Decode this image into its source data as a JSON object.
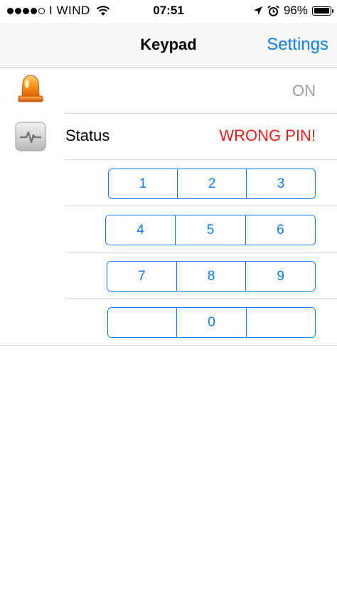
{
  "status_bar": {
    "carrier": "I WIND",
    "time": "07:51",
    "battery": "96%",
    "battery_level": 0.96,
    "signal_bars_filled": 4,
    "signal_bars_total": 5,
    "icons": [
      "wifi-icon",
      "location-arrow-icon",
      "alarm-icon",
      "battery-icon"
    ]
  },
  "nav": {
    "title": "Keypad",
    "settings_label": "Settings"
  },
  "alarm_row": {
    "icon": "siren-icon",
    "state": "ON"
  },
  "status_row": {
    "icon": "pulse-monitor-icon",
    "label": "Status",
    "value": "WRONG PIN!"
  },
  "keypad": {
    "rows": [
      [
        "1",
        "2",
        "3"
      ],
      [
        "4",
        "5",
        "6"
      ],
      [
        "7",
        "8",
        "9"
      ],
      [
        "",
        "0",
        ""
      ]
    ]
  },
  "colors": {
    "accent": "#0a7ff5",
    "error": "#ec1b1b",
    "muted": "#9b9b9b"
  }
}
